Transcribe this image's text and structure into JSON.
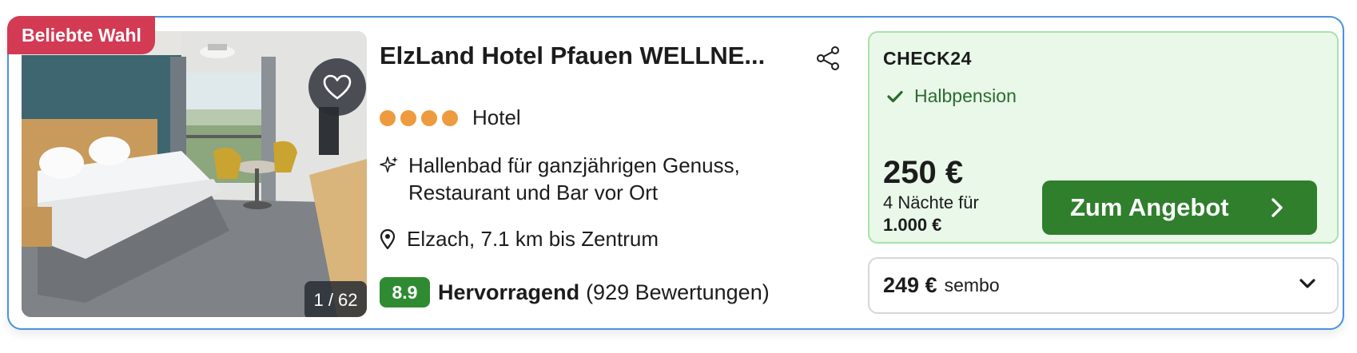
{
  "badge": "Beliebte Wahl",
  "image": {
    "counter": "1 / 62"
  },
  "hotel": {
    "name": "ElzLand Hotel Pfauen WELLNE...",
    "star_count": 4,
    "type": "Hotel",
    "feature_line1": "Hallenbad für ganzjährigen Genuss,",
    "feature_line2": "Restaurant und Bar vor Ort",
    "location": "Elzach, 7.1 km bis Zentrum"
  },
  "rating": {
    "score": "8.9",
    "label": "Hervorragend",
    "count": "(929 Bewertungen)"
  },
  "offer": {
    "provider": "CHECK24",
    "board": "Halbpension",
    "price": "250 €",
    "nights": "4 Nächte für",
    "total": "1.000 €",
    "cta": "Zum Angebot"
  },
  "alt_offer": {
    "price": "249 €",
    "provider": "sembo"
  },
  "colors": {
    "badge": "#d33a54",
    "stars": "#ee9a3e",
    "score": "#2e8b31",
    "cta": "#2f7f2c",
    "offer_bg": "#e9f8e9",
    "card_border": "#4a90e2"
  },
  "icons": [
    "heart-icon",
    "share-icon",
    "sparkle-icon",
    "location-pin-icon",
    "check-icon",
    "chevron-right-icon",
    "chevron-down-icon"
  ]
}
